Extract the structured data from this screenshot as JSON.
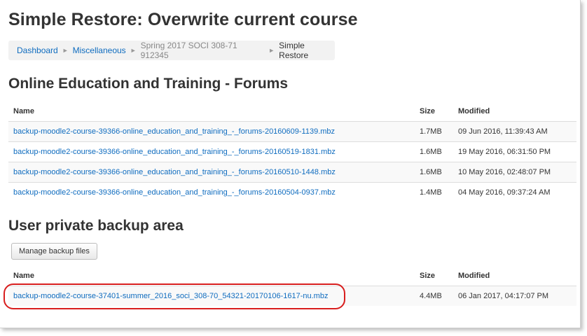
{
  "page_title": "Simple Restore: Overwrite current course",
  "breadcrumb": {
    "items": [
      "Dashboard",
      "Miscellaneous",
      "Spring 2017 SOCI 308-71 912345",
      "Simple Restore"
    ],
    "separator": "►"
  },
  "section1": {
    "title": "Online Education and Training - Forums",
    "headers": {
      "name": "Name",
      "size": "Size",
      "modified": "Modified"
    },
    "rows": [
      {
        "name": "backup-moodle2-course-39366-online_education_and_training_-_forums-20160609-1139.mbz",
        "size": "1.7MB",
        "modified": "09 Jun 2016, 11:39:43 AM"
      },
      {
        "name": "backup-moodle2-course-39366-online_education_and_training_-_forums-20160519-1831.mbz",
        "size": "1.6MB",
        "modified": "19 May 2016, 06:31:50 PM"
      },
      {
        "name": "backup-moodle2-course-39366-online_education_and_training_-_forums-20160510-1448.mbz",
        "size": "1.6MB",
        "modified": "10 May 2016, 02:48:07 PM"
      },
      {
        "name": "backup-moodle2-course-39366-online_education_and_training_-_forums-20160504-0937.mbz",
        "size": "1.4MB",
        "modified": "04 May 2016, 09:37:24 AM"
      }
    ]
  },
  "section2": {
    "title": "User private backup area",
    "manage_button": "Manage backup files",
    "headers": {
      "name": "Name",
      "size": "Size",
      "modified": "Modified"
    },
    "rows": [
      {
        "name": "backup-moodle2-course-37401-summer_2016_soci_308-70_54321-20170106-1617-nu.mbz",
        "size": "4.4MB",
        "modified": "06 Jan 2017, 04:17:07 PM"
      }
    ]
  },
  "colors": {
    "link": "#0f6cbf",
    "highlight": "#d81e1e",
    "breadcrumb_bg": "#f2f2f2"
  }
}
